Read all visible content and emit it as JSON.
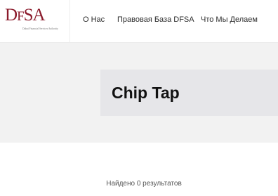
{
  "header": {
    "logo": {
      "text": "DFSA",
      "subtitle": "Dubai Financial Services Authority"
    },
    "nav": [
      {
        "label": "О Нас"
      },
      {
        "label": "Правовая База DFSA"
      },
      {
        "label": "Что Мы Делаем"
      }
    ]
  },
  "hero": {
    "title": "Chip Tap"
  },
  "search": {
    "results_text": "Найдено 0 результатов"
  },
  "colors": {
    "brand": "#8b1b2c",
    "hero_bg": "#f2f2f2",
    "title_box_bg": "#e6e6e9"
  }
}
